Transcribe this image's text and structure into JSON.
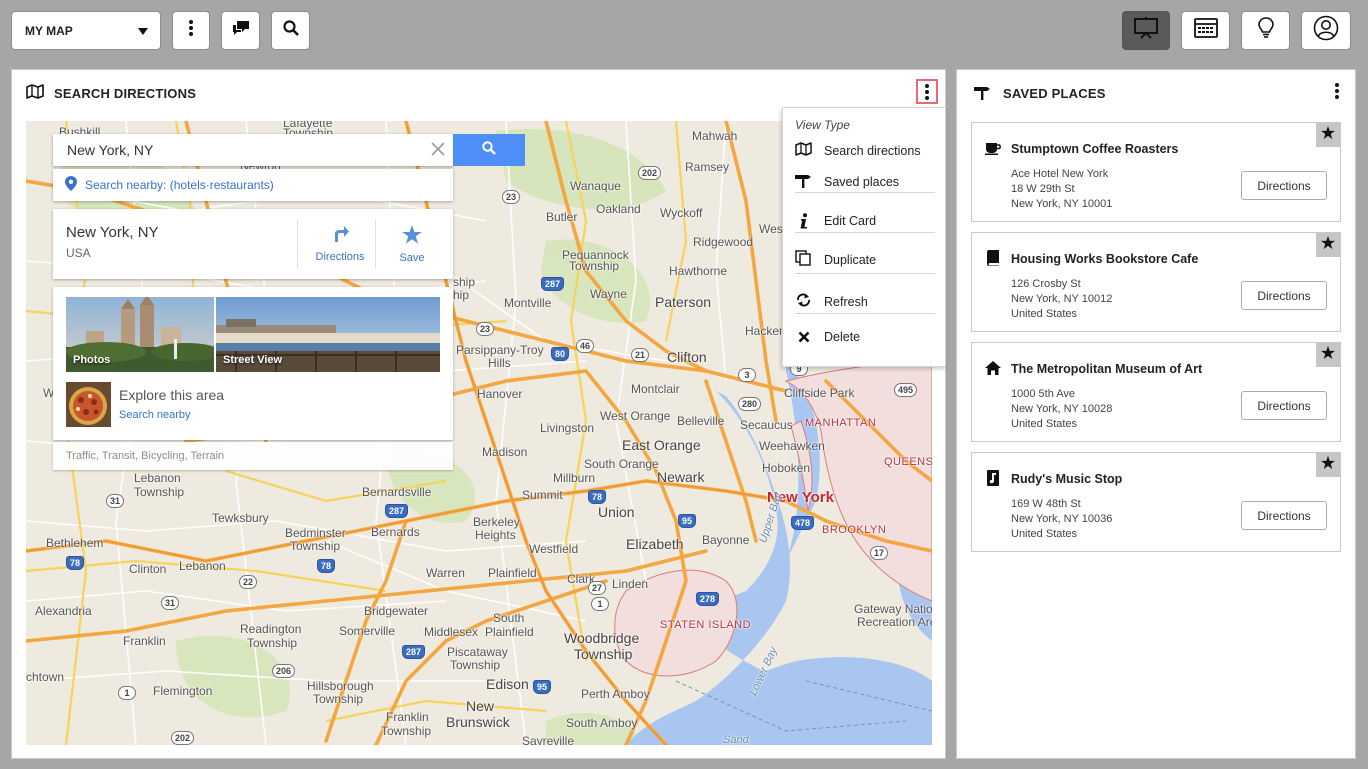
{
  "topbar": {
    "map_select_label": "MY MAP",
    "buttons": [
      "more-options",
      "comments",
      "search"
    ],
    "right_buttons": [
      "presentation",
      "calendar",
      "lightbulb",
      "user"
    ]
  },
  "left_panel": {
    "title": "SEARCH DIRECTIONS",
    "menu_icon": "vertical-ellipsis-icon"
  },
  "map": {
    "search_value": "New York, NY",
    "nearby": {
      "prefix": "Search nearby:",
      "link": "(hotels·restaurants)"
    },
    "result": {
      "title": "New York, NY",
      "subtitle": "USA",
      "directions_label": "Directions",
      "save_label": "Save"
    },
    "media": {
      "photos_label": "Photos",
      "street_view_label": "Street View",
      "explore_title": "Explore this area",
      "explore_link": "Search nearby"
    },
    "layers": "Traffic, Transit, Bicycling, Terrain",
    "labels": {
      "bushkill": "Bushkill",
      "lafayette": "Lafayette",
      "township1": "Township",
      "newton": "Newton",
      "mahwah": "Mahwah",
      "ramsey": "Ramsey",
      "wanaque": "Wanaque",
      "oakland": "Oakland",
      "wyckoff": "Wyckoff",
      "butler": "Butler",
      "ridgewood": "Ridgewood",
      "pequannock": "Pequannock",
      "pequannock_twp": "Township",
      "hawthorne": "Hawthorne",
      "wayne": "Wayne",
      "montville": "Montville",
      "paterson": "Paterson",
      "hacken": "Hacken",
      "parsippany": "Parsippany-Troy",
      "hills": "Hills",
      "clifton": "Clifton",
      "montclair": "Montclair",
      "cliffside": "Cliffside Park",
      "hanover": "Hanover",
      "west_orange": "West Orange",
      "belleville": "Belleville",
      "secaucus": "Secaucus",
      "manhattan": "MANHATTAN",
      "livingston": "Livingston",
      "weehawken": "Weehawken",
      "east_orange": "East Orange",
      "hoboken": "Hoboken",
      "queens": "QUEENS",
      "madison": "Madison",
      "south_orange": "South Orange",
      "millburn": "Millburn",
      "newark": "Newark",
      "new_york": "New York",
      "lebanon_twp": "Lebanon",
      "lebanon_twp2": "Township",
      "bernardsville": "Bernardsville",
      "summit": "Summit",
      "union": "Union",
      "tewksbury": "Tewksbury",
      "bedminster": "Bedminster",
      "bedminster_twp": "Township",
      "berkeley": "Berkeley",
      "heights": "Heights",
      "bernards": "Bernards",
      "elizabeth": "Elizabeth",
      "bayonne": "Bayonne",
      "brooklyn": "BROOKLYN",
      "bethlehem": "Bethlehem",
      "westfield": "Westfield",
      "clinton": "Clinton",
      "lebanon": "Lebanon",
      "warren": "Warren",
      "plainfield": "Plainfield",
      "clark": "Clark",
      "linden": "Linden",
      "upper_bay": "Upper Bay",
      "alexandria": "Alexandria",
      "bridgewater": "Bridgewater",
      "south_plainfield": "South",
      "south_plainfield2": "Plainfield",
      "gateway": "Gateway Nation",
      "recreation": "Recreation Are",
      "franklin": "Franklin",
      "readington": "Readington",
      "readington_twp": "Township",
      "somerville": "Somerville",
      "middlesex": "Middlesex",
      "piscataway": "Piscataway",
      "piscataway_twp": "Township",
      "staten_island": "STATEN ISLAND",
      "woodbridge": "Woodbridge",
      "woodbridge_twp": "Township",
      "lower_bay": "Lower Bay",
      "flemington": "Flemington",
      "hillsborough": "Hillsborough",
      "hillsborough_twp": "Township",
      "edison": "Edison",
      "perth_amboy": "Perth Amboy",
      "new_brunswick": "New",
      "new_brunswick2": "Brunswick",
      "franklin_twp": "Franklin",
      "franklin_twp2": "Township",
      "south_amboy": "South Amboy",
      "sayreville": "Sayreville",
      "sandy": "Sand",
      "wh": "Wh",
      "chtown": "chtown",
      "hip": "ship",
      "west": "West",
      "hip2": "hip"
    },
    "shields": {
      "s23": "23",
      "s202": "202",
      "s287a": "287",
      "s80": "80",
      "s46": "46",
      "s23b": "23",
      "s3": "3",
      "s17": "17",
      "s21": "21",
      "s280": "280",
      "s9a": "9",
      "s78a": "78",
      "s287b": "287",
      "s95a": "95",
      "s478": "478",
      "s31a": "31",
      "s22": "22",
      "s78b": "78",
      "s1": "1",
      "s27": "27",
      "s278": "278",
      "s287c": "287",
      "s31b": "31",
      "s202b": "202",
      "s206": "206",
      "s95b": "95",
      "s1b": "1",
      "s495": "495",
      "s78c": "78"
    }
  },
  "dropdown": {
    "title": "View Type",
    "items": [
      {
        "label": "Search directions",
        "icon": "map-icon"
      },
      {
        "label": "Saved places",
        "icon": "signpost-icon"
      },
      {
        "label": "Edit Card",
        "icon": "info-icon"
      },
      {
        "label": "Duplicate",
        "icon": "duplicate-icon"
      },
      {
        "label": "Refresh",
        "icon": "refresh-icon"
      },
      {
        "label": "Delete",
        "icon": "close-icon"
      }
    ]
  },
  "right_panel": {
    "title": "SAVED PLACES",
    "places": [
      {
        "name": "Stumptown Coffee Roasters",
        "icon": "coffee-icon",
        "lines": [
          "Ace Hotel New York",
          "18 W 29th St",
          "New York, NY 10001"
        ],
        "button": "Directions"
      },
      {
        "name": "Housing Works Bookstore Cafe",
        "icon": "book-icon",
        "lines": [
          "126 Crosby St",
          "New York, NY 10012",
          "United States"
        ],
        "button": "Directions"
      },
      {
        "name": "The Metropolitan Museum of Art",
        "icon": "home-icon",
        "lines": [
          "1000 5th Ave",
          "New York, NY 10028",
          "United States"
        ],
        "button": "Directions"
      },
      {
        "name": "Rudy's Music Stop",
        "icon": "music-note-icon",
        "lines": [
          "169 W 48th St",
          "New York, NY 10036",
          "United States"
        ],
        "button": "Directions"
      }
    ]
  },
  "colors": {
    "accent": "#4d8ff6",
    "link": "#3773cf",
    "highlight_border": "#e8696f",
    "map_land": "#efeadf",
    "highway": "#f4a640",
    "water": "#a9c6f1"
  }
}
